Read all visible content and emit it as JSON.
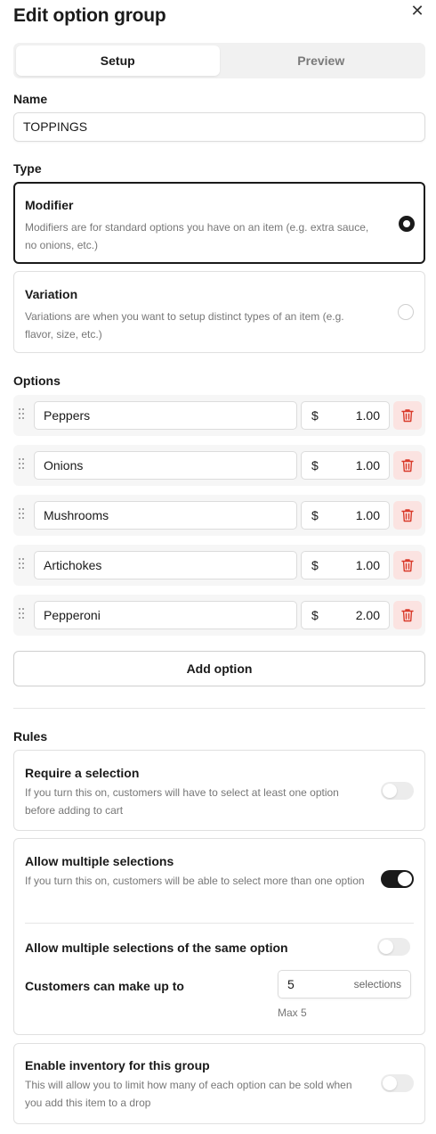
{
  "header": {
    "title": "Edit option group",
    "close_icon": "close-icon"
  },
  "tabs": [
    {
      "label": "Setup",
      "active": true
    },
    {
      "label": "Preview",
      "active": false
    }
  ],
  "name": {
    "label": "Name",
    "value": "TOPPINGS"
  },
  "type": {
    "label": "Type",
    "options": [
      {
        "title": "Modifier",
        "description": "Modifiers are for standard options you have on an item (e.g. extra sauce, no onions, etc.)",
        "selected": true
      },
      {
        "title": "Variation",
        "description": "Variations are when you want to setup distinct types of an item (e.g. flavor, size, etc.)",
        "selected": false
      }
    ]
  },
  "options": {
    "label": "Options",
    "currency": "$",
    "items": [
      {
        "name": "Peppers",
        "price": "1.00"
      },
      {
        "name": "Onions",
        "price": "1.00"
      },
      {
        "name": "Mushrooms",
        "price": "1.00"
      },
      {
        "name": "Artichokes",
        "price": "1.00"
      },
      {
        "name": "Pepperoni",
        "price": "2.00"
      }
    ],
    "add_label": "Add option"
  },
  "rules": {
    "label": "Rules",
    "require": {
      "title": "Require a selection",
      "description": "If you turn this on, customers will have to select at least one option before adding to cart",
      "enabled": false
    },
    "multiple": {
      "title": "Allow multiple selections",
      "description": "If you turn this on, customers will be able to select more than one option",
      "enabled": true
    },
    "same_option": {
      "title": "Allow multiple selections of the same option",
      "enabled": false
    },
    "limit": {
      "label": "Customers can make up to",
      "value": "5",
      "unit": "selections",
      "note": "Max 5"
    },
    "inventory": {
      "title": "Enable inventory for this group",
      "description": "This will allow you to limit how many of each option can be sold when you add this item to a drop",
      "enabled": false
    }
  },
  "colors": {
    "accent": "#1a1a1a",
    "danger_bg": "#fbe3e1",
    "danger": "#d93b2b",
    "muted": "#777777"
  }
}
